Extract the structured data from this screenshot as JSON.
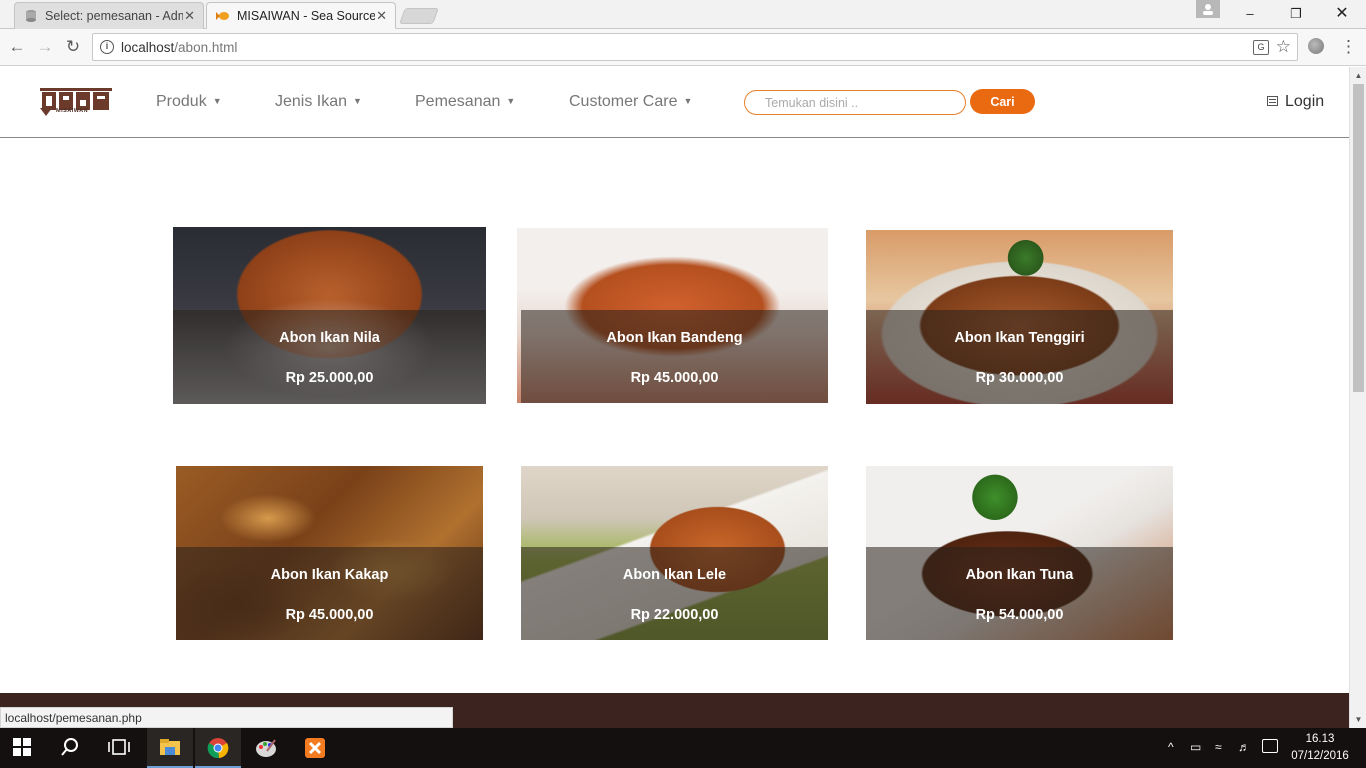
{
  "browser": {
    "tabs": [
      {
        "title": "Select: pemesanan - Adm",
        "active": false
      },
      {
        "title": "MISAIWAN - Sea Source",
        "active": true
      }
    ],
    "url_host": "localhost",
    "url_path": "/abon.html",
    "status_url": "localhost/pemesanan.php"
  },
  "site": {
    "logo_text": "MISAIWAN",
    "nav": [
      {
        "label": "Produk"
      },
      {
        "label": "Jenis Ikan"
      },
      {
        "label": "Pemesanan"
      },
      {
        "label": "Customer Care"
      }
    ],
    "search": {
      "placeholder": "Temukan disini ..",
      "button": "Cari"
    },
    "login_label": "Login"
  },
  "products": [
    {
      "name": "Abon Ikan Nila",
      "price": "Rp 25.000,00"
    },
    {
      "name": "Abon Ikan Bandeng",
      "price": "Rp 45.000,00"
    },
    {
      "name": "Abon Ikan Tenggiri",
      "price": "Rp 30.000,00"
    },
    {
      "name": "Abon Ikan Kakap",
      "price": "Rp 45.000,00"
    },
    {
      "name": "Abon Ikan Lele",
      "price": "Rp 22.000,00"
    },
    {
      "name": "Abon Ikan Tuna",
      "price": "Rp 54.000,00"
    }
  ],
  "taskbar": {
    "time": "16.13",
    "date": "07/12/2016"
  },
  "colors": {
    "accent": "#ea6a12",
    "footer": "#3c2320",
    "logo": "#6b3a2a"
  },
  "icons": [
    "info-icon",
    "translate-icon",
    "star-icon",
    "menu-icon",
    "list-icon",
    "windows-icon",
    "search-icon",
    "chrome-icon"
  ]
}
